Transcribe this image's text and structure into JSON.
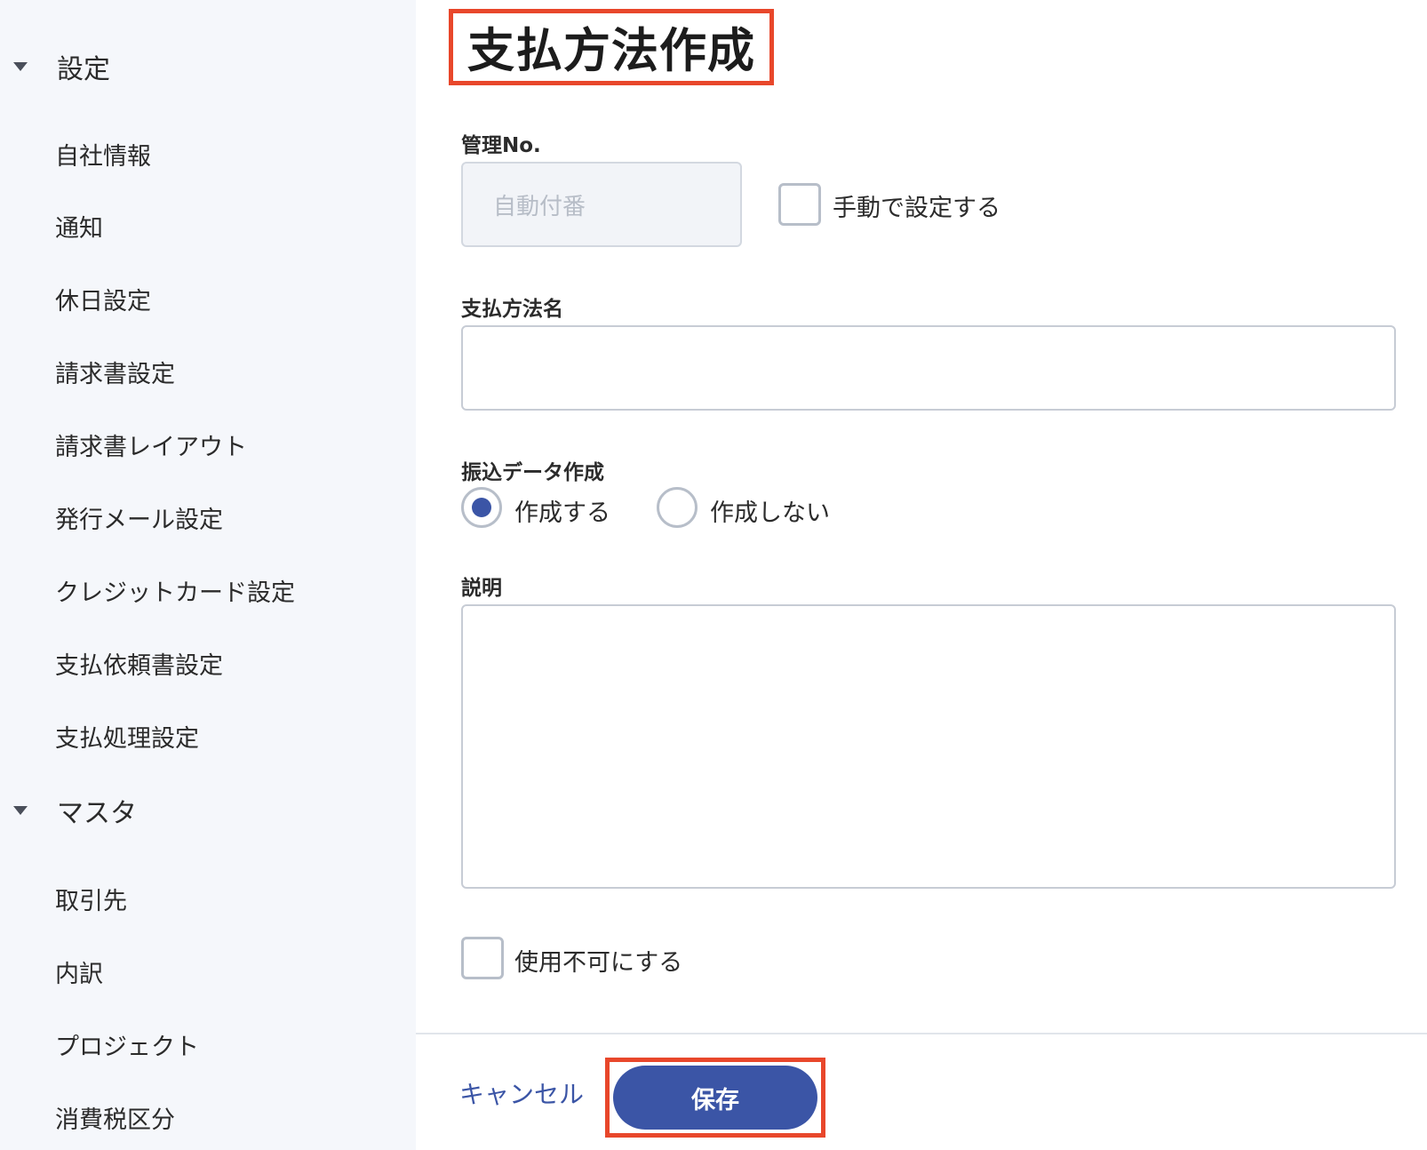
{
  "sidebar": {
    "sections": [
      {
        "label": "設定",
        "items": [
          "自社情報",
          "通知",
          "休日設定",
          "請求書設定",
          "請求書レイアウト",
          "発行メール設定",
          "クレジットカード設定",
          "支払依頼書設定",
          "支払処理設定"
        ]
      },
      {
        "label": "マスタ",
        "items": [
          "取引先",
          "内訳",
          "プロジェクト",
          "消費税区分"
        ]
      }
    ]
  },
  "main": {
    "title": "支払方法作成",
    "management_no": {
      "label": "管理No.",
      "placeholder": "自動付番",
      "manual_checkbox_label": "手動で設定する"
    },
    "payment_method_name": {
      "label": "支払方法名",
      "value": ""
    },
    "transfer_data": {
      "label": "振込データ作成",
      "options": [
        "作成する",
        "作成しない"
      ],
      "selected": "作成する"
    },
    "description": {
      "label": "説明",
      "value": ""
    },
    "disable_checkbox_label": "使用不可にする"
  },
  "footer": {
    "cancel_label": "キャンセル",
    "save_label": "保存"
  },
  "colors": {
    "accent": "#3b55a6",
    "highlight": "#e8472b",
    "sidebar_bg": "#f5f7fb"
  }
}
